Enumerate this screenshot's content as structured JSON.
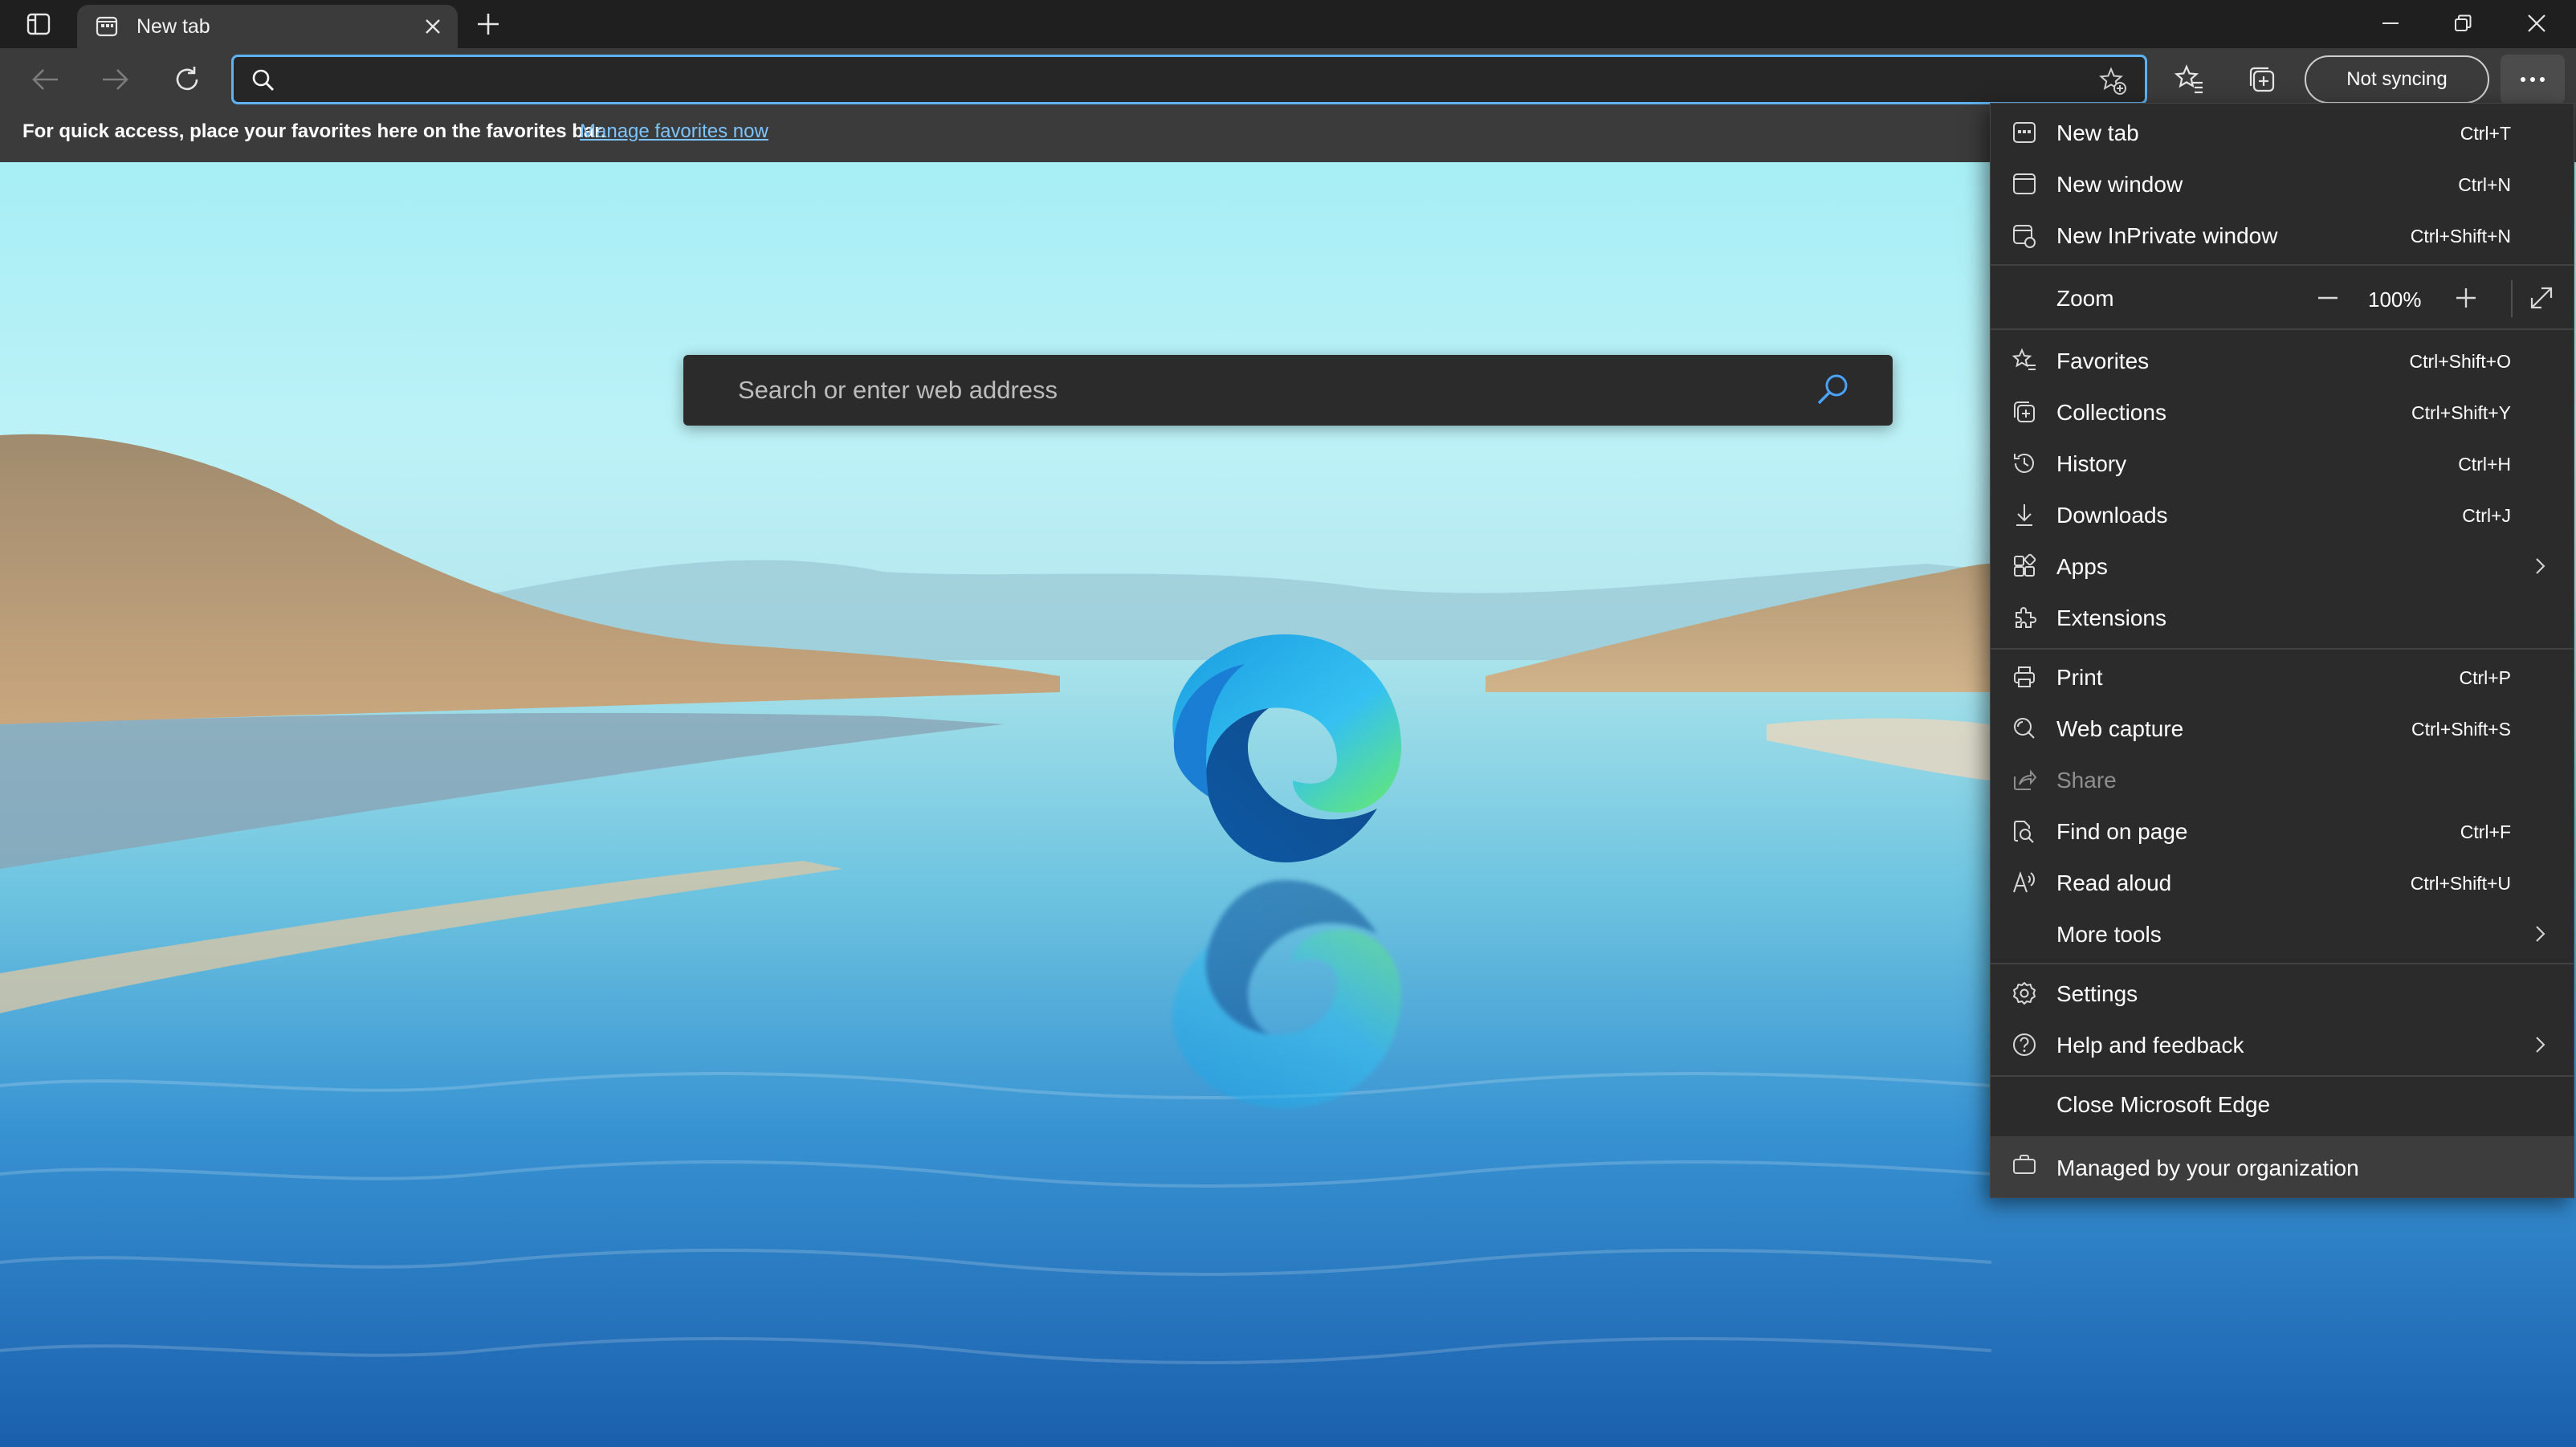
{
  "tab": {
    "title": "New tab"
  },
  "toolbar": {
    "address_value": "",
    "sync_label": "Not syncing"
  },
  "favorites_bar": {
    "message": "For quick access, place your favorites here on the favorites bar.",
    "link": "Manage favorites now"
  },
  "page": {
    "search_placeholder": "Search or enter web address"
  },
  "menu": {
    "new_tab": {
      "label": "New tab",
      "shortcut": "Ctrl+T"
    },
    "new_window": {
      "label": "New window",
      "shortcut": "Ctrl+N"
    },
    "new_inprivate": {
      "label": "New InPrivate window",
      "shortcut": "Ctrl+Shift+N"
    },
    "zoom": {
      "label": "Zoom",
      "value": "100%"
    },
    "favorites": {
      "label": "Favorites",
      "shortcut": "Ctrl+Shift+O"
    },
    "collections": {
      "label": "Collections",
      "shortcut": "Ctrl+Shift+Y"
    },
    "history": {
      "label": "History",
      "shortcut": "Ctrl+H"
    },
    "downloads": {
      "label": "Downloads",
      "shortcut": "Ctrl+J"
    },
    "apps": {
      "label": "Apps"
    },
    "extensions": {
      "label": "Extensions"
    },
    "print": {
      "label": "Print",
      "shortcut": "Ctrl+P"
    },
    "web_capture": {
      "label": "Web capture",
      "shortcut": "Ctrl+Shift+S"
    },
    "share": {
      "label": "Share"
    },
    "find_on_page": {
      "label": "Find on page",
      "shortcut": "Ctrl+F"
    },
    "read_aloud": {
      "label": "Read aloud",
      "shortcut": "Ctrl+Shift+U"
    },
    "more_tools": {
      "label": "More tools"
    },
    "settings": {
      "label": "Settings"
    },
    "help": {
      "label": "Help and feedback"
    },
    "close_edge": {
      "label": "Close Microsoft Edge"
    },
    "managed": {
      "label": "Managed by your organization"
    }
  },
  "colors": {
    "accent": "#5fb2f2",
    "link": "#7cc4ff",
    "menu_bg": "#2b2b2b",
    "toolbar_bg": "#3b3b3b"
  }
}
